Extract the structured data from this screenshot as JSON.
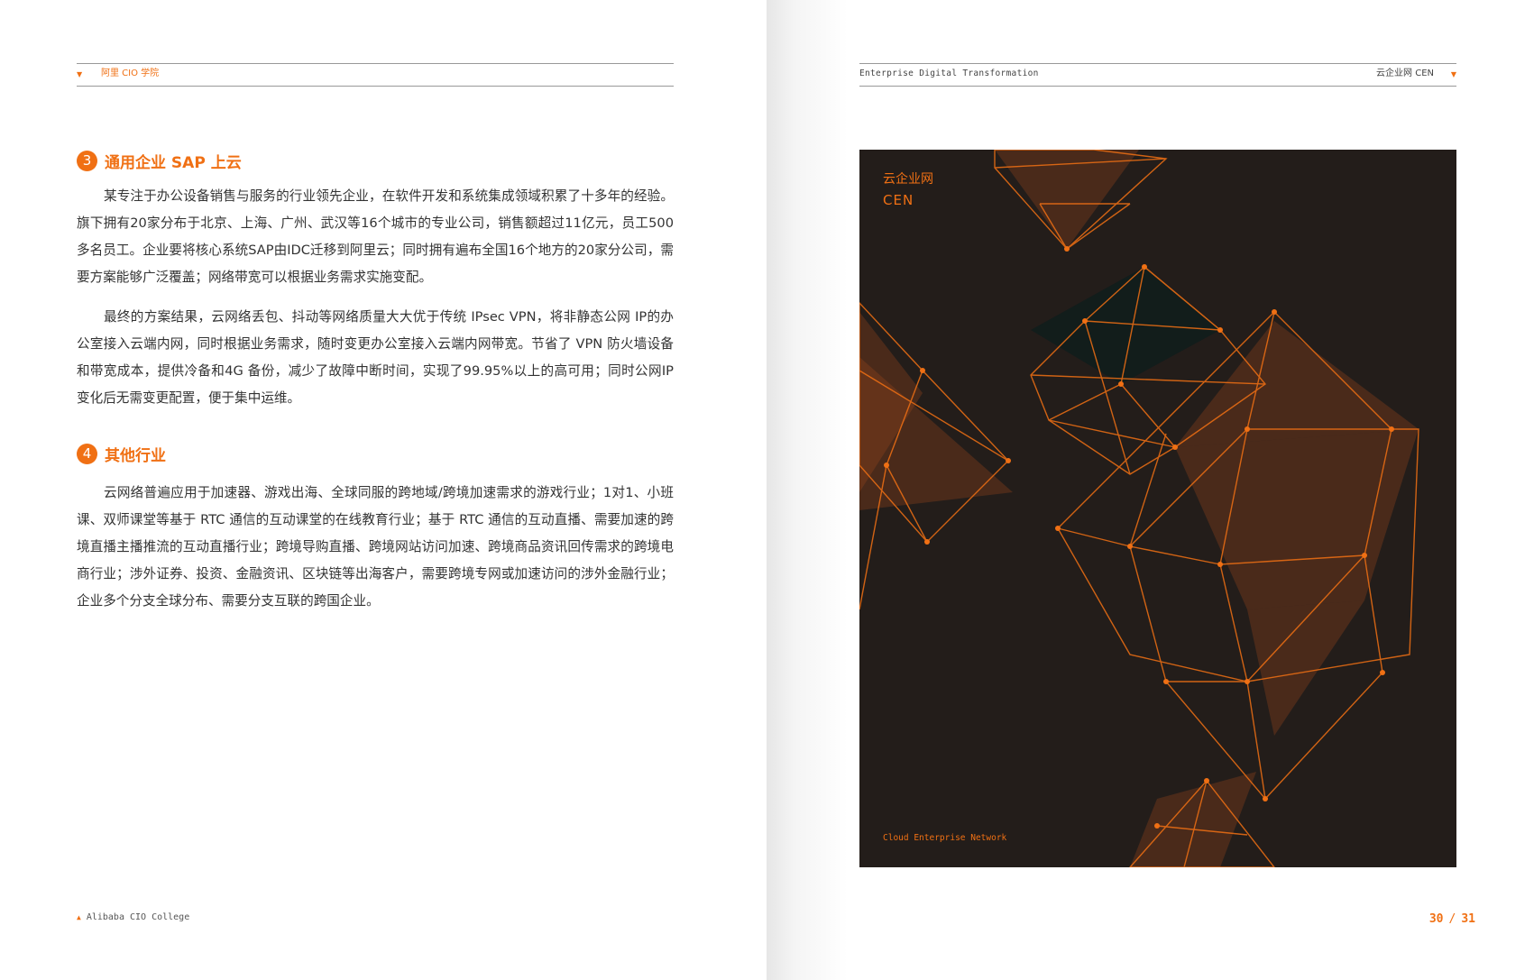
{
  "left_page": {
    "header": {
      "title": "阿里 CIO 学院"
    },
    "sections": [
      {
        "number": "3",
        "title": "通用企业 SAP 上云",
        "paragraphs": [
          "某专注于办公设备销售与服务的行业领先企业，在软件开发和系统集成领域积累了十多年的经验。旗下拥有20家分布于北京、上海、广州、武汉等16个城市的专业公司，销售额超过11亿元，员工500多名员工。企业要将核心系统SAP由IDC迁移到阿里云；同时拥有遍布全国16个地方的20家分公司，需要方案能够广泛覆盖；网络带宽可以根据业务需求实施变配。",
          "最终的方案结果，云网络丢包、抖动等网络质量大大优于传统 IPsec VPN，将非静态公网 IP的办公室接入云端内网，同时根据业务需求，随时变更办公室接入云端内网带宽。节省了 VPN 防火墙设备和带宽成本，提供冷备和4G 备份，减少了故障中断时间，实现了99.95%以上的高可用；同时公网IP变化后无需变更配置，便于集中运维。"
        ]
      },
      {
        "number": "4",
        "title": "其他行业",
        "paragraphs": [
          "云网络普遍应用于加速器、游戏出海、全球同服的跨地域/跨境加速需求的游戏行业；1对1、小班课、双师课堂等基于 RTC 通信的互动课堂的在线教育行业；基于 RTC 通信的互动直播、需要加速的跨境直播主播推流的互动直播行业；跨境导购直播、跨境网站访问加速、跨境商品资讯回传需求的跨境电商行业；涉外证券、投资、金融资讯、区块链等出海客户，需要跨境专网或加速访问的涉外金融行业；企业多个分支全球分布、需要分支互联的跨国企业。"
        ]
      }
    ],
    "footer": {
      "text": "Alibaba CIO College"
    }
  },
  "right_page": {
    "header": {
      "english": "Enterprise Digital Transformation",
      "chinese": "云企业网 CEN"
    },
    "cover": {
      "title_cn": "云企业网",
      "title_en": "CEN",
      "subtitle": "Cloud Enterprise Network",
      "background_color": "#231d1a",
      "accent_color": "#f07014"
    },
    "page_numbers": {
      "left": "30",
      "separator": "/",
      "right": "31"
    }
  },
  "colors": {
    "accent": "#f07014",
    "text": "#333333",
    "rule": "#999999"
  }
}
